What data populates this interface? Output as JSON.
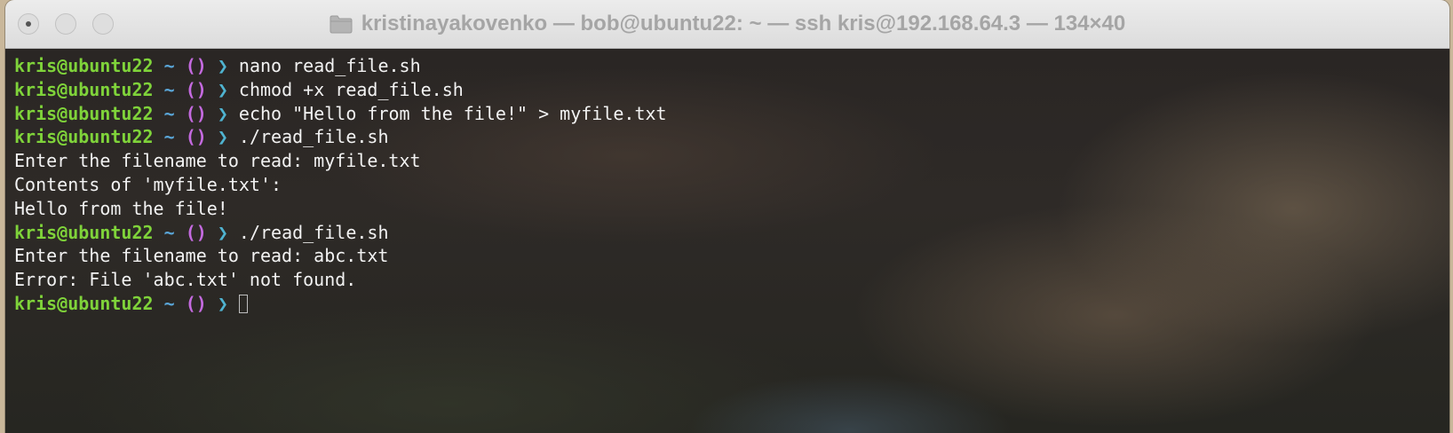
{
  "window": {
    "title": "kristinayakovenko — bob@ubuntu22: ~ — ssh kris@192.168.64.3 — 134×40"
  },
  "prompt": {
    "user_host": "kris@ubuntu22",
    "dir": "~",
    "git": "()",
    "arrow": "❯"
  },
  "colors": {
    "user_host": "#7fd33a",
    "dir": "#5aa6d8",
    "git": "#c46adf",
    "arrow": "#4fb3d0",
    "text": "#f2f2f2"
  },
  "terminal": {
    "lines": [
      {
        "type": "prompt",
        "text": "nano read_file.sh"
      },
      {
        "type": "prompt",
        "text": "chmod +x read_file.sh"
      },
      {
        "type": "prompt",
        "text": "echo \"Hello from the file!\" > myfile.txt"
      },
      {
        "type": "prompt",
        "text": "./read_file.sh"
      },
      {
        "type": "output",
        "text": "Enter the filename to read: myfile.txt"
      },
      {
        "type": "output",
        "text": "Contents of 'myfile.txt':"
      },
      {
        "type": "output",
        "text": "Hello from the file!"
      },
      {
        "type": "prompt",
        "text": "./read_file.sh"
      },
      {
        "type": "output",
        "text": "Enter the filename to read: abc.txt"
      },
      {
        "type": "output",
        "text": "Error: File 'abc.txt' not found."
      },
      {
        "type": "prompt",
        "text": ""
      }
    ]
  }
}
